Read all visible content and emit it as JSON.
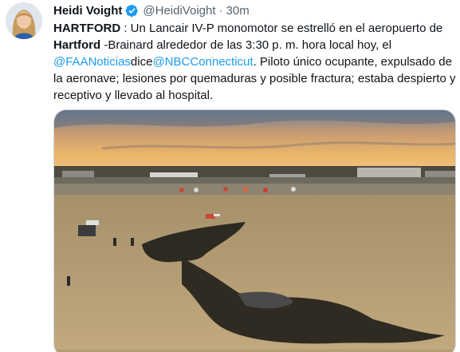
{
  "tweet": {
    "author": {
      "display_name": "Heidi Voight",
      "handle": "@HeidiVoight",
      "verified": true,
      "avatar_icon": "profile-photo"
    },
    "separator": "·",
    "timestamp": "30m",
    "text": {
      "p1_bold": "HARTFORD",
      "p2": " : Un Lancair IV-P monomotor se estrelló en el aeropuerto de ",
      "p3_bold": "Hartford",
      "p4": " -Brainard alrededor de las 3:30 p. m. hora local hoy, el ",
      "mention1": "@FAANoticias",
      "p5": "dice",
      "mention2": "@NBCConnecticut",
      "p6": ". Piloto único ocupante, expulsado de la aeronave; lesiones por quemaduras y posible fractura; estaba despierto y receptivo y llevado al hospital."
    },
    "media": {
      "type": "photo",
      "accent_sky": "#e9b870",
      "accent_field": "#b9a27a"
    },
    "colors": {
      "link": "#1d9bf0",
      "verified": "#1d9bf0",
      "secondary_text": "#536471"
    }
  }
}
